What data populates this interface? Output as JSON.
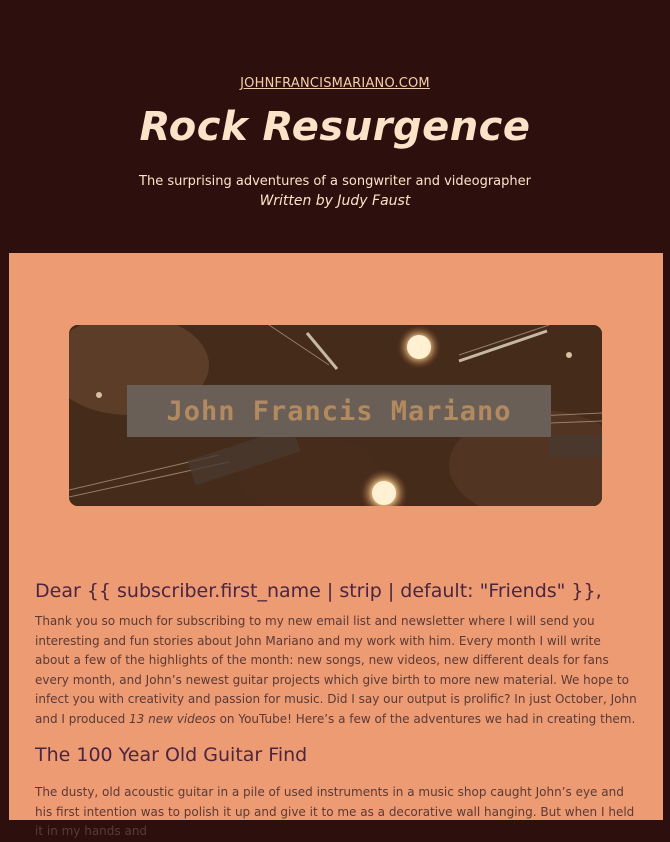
{
  "header": {
    "site_link": "JOHNFRANCISMARIANO.COM",
    "title": "Rock Resurgence",
    "tagline": "The surprising adventures of a songwriter and videographer",
    "byline": "Written by Judy Faust"
  },
  "banner": {
    "text": "John Francis Mariano",
    "image": "guitars-and-candles-photo"
  },
  "content": {
    "greeting": "Dear {{ subscriber.first_name | strip | default: \"Friends\" }},",
    "intro_before": "Thank you so much for subscribing to my new email list and newsletter where I will send you interesting and fun stories about John Mariano and my work with him. Every month I will write about a few of the highlights of the month: new songs, new videos, new different deals for fans every month, and John’s newest guitar projects which give birth to more new material. We hope to infect you with creativity and passion for music. Did I say our output is prolific? In just October, John and I produced ",
    "intro_italic": "13 new videos",
    "intro_after": " on YouTube! Here’s a few of the adventures we had in creating them.",
    "section_title": "The 100 Year Old Guitar Find",
    "section_body": "The dusty, old acoustic guitar in a pile of used instruments in a music shop caught John’s eye and his first intention was to polish it up and give it to me as a decorative wall hanging. But when I held it in my hands and"
  },
  "colors": {
    "header_bg": "#2d100d",
    "panel_bg": "#ed9b73",
    "title": "#fbe3c7",
    "heading": "#4a2640",
    "body_text": "#5a3a36"
  }
}
